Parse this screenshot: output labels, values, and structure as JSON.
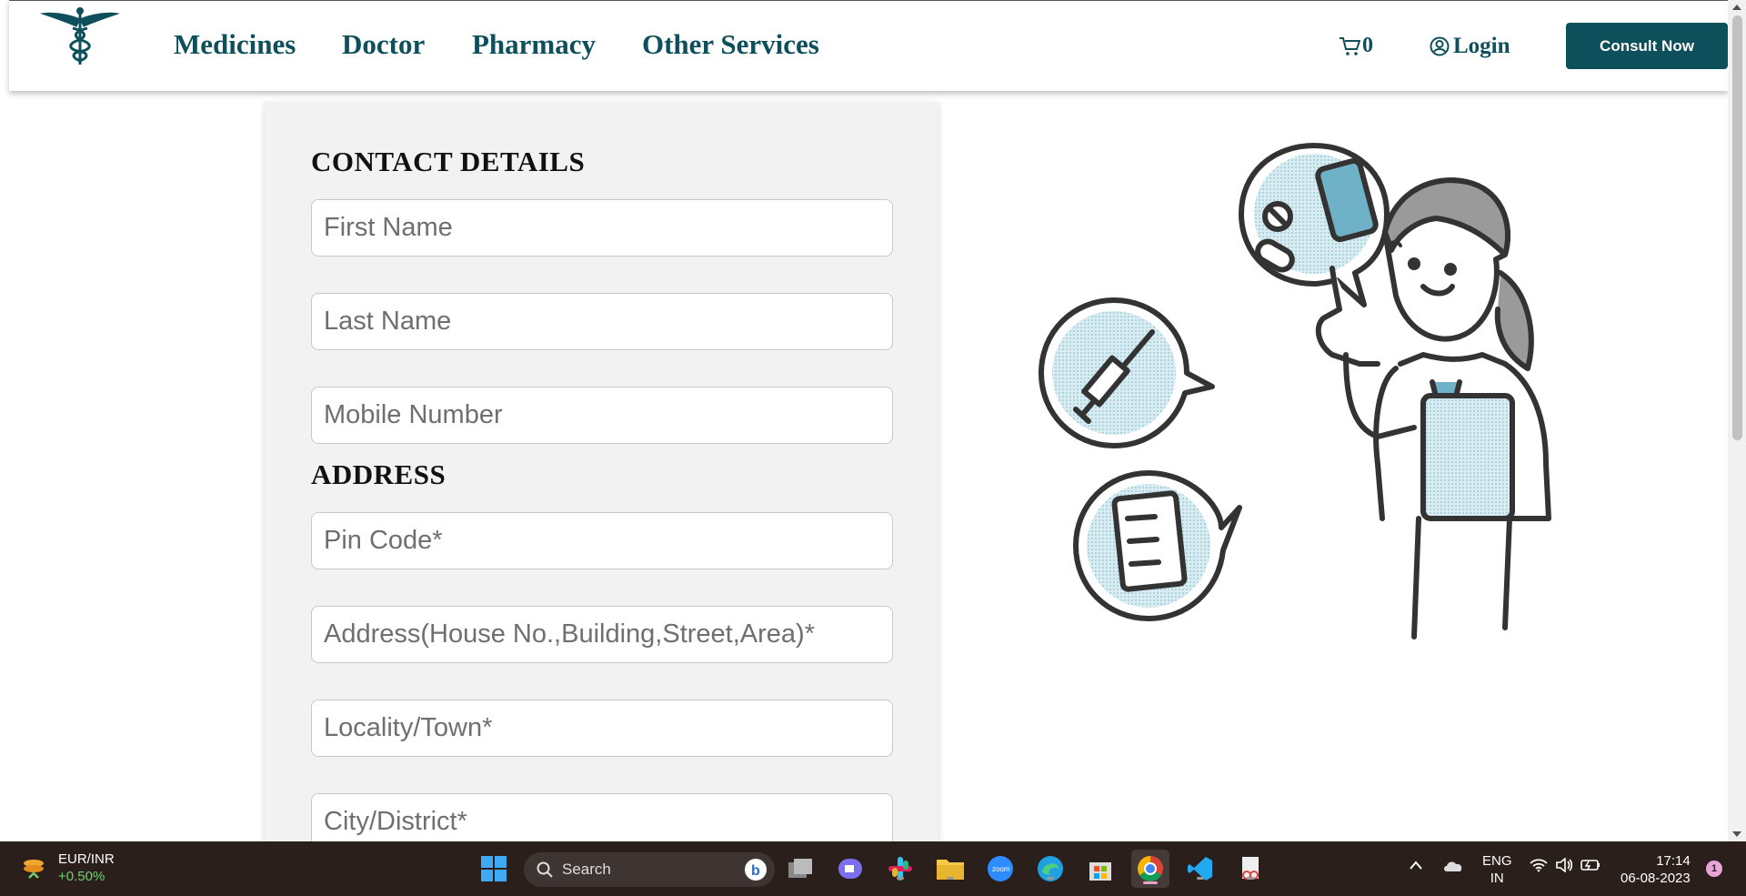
{
  "navbar": {
    "links": [
      "Medicines",
      "Doctor",
      "Pharmacy",
      "Other Services"
    ],
    "cart_count": "0",
    "login_label": "Login",
    "consult_label": "Consult Now"
  },
  "form": {
    "contact_title": "CONTACT DETAILS",
    "address_title": "ADDRESS",
    "fields": {
      "first_name": "First Name",
      "last_name": "Last Name",
      "mobile": "Mobile Number",
      "pin": "Pin Code*",
      "address": "Address(House No.,Building,Street,Area)*",
      "locality": "Locality/Town*",
      "city": "City/District*"
    }
  },
  "taskbar": {
    "widget_title": "EUR/INR",
    "widget_change": "+0.50%",
    "search_placeholder": "Search",
    "lang_line1": "ENG",
    "lang_line2": "IN",
    "time": "17:14",
    "date": "06-08-2023",
    "notification_count": "1"
  },
  "colors": {
    "brand": "#0e4f5c",
    "card_bg": "#f2f2f2",
    "taskbar_bg": "#2b1f1c"
  }
}
